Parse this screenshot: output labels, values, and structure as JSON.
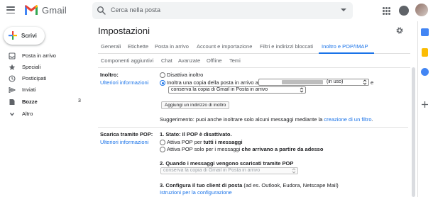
{
  "header": {
    "logo_text": "Gmail",
    "search_placeholder": "Cerca nella posta"
  },
  "compose": {
    "label": "Scrivi"
  },
  "sidebar": {
    "items": [
      {
        "label": "Posta in arrivo",
        "icon": "inbox-icon",
        "count": ""
      },
      {
        "label": "Speciali",
        "icon": "star-icon",
        "count": ""
      },
      {
        "label": "Posticipati",
        "icon": "clock-icon",
        "count": ""
      },
      {
        "label": "Inviati",
        "icon": "send-icon",
        "count": ""
      },
      {
        "label": "Bozze",
        "icon": "draft-icon",
        "count": "3"
      },
      {
        "label": "Altro",
        "icon": "chevron-down-icon",
        "count": ""
      }
    ]
  },
  "settings": {
    "title": "Impostazioni",
    "tabs_row1": [
      {
        "label": "Generali"
      },
      {
        "label": "Etichette"
      },
      {
        "label": "Posta in arrivo"
      },
      {
        "label": "Account e importazione"
      },
      {
        "label": "Filtri e indirizzi bloccati"
      },
      {
        "label": "Inoltro e POP/IMAP",
        "active": true
      }
    ],
    "tabs_row2": [
      {
        "label": "Componenti aggiuntivi"
      },
      {
        "label": "Chat"
      },
      {
        "label": "Avanzate"
      },
      {
        "label": "Offline"
      },
      {
        "label": "Temi"
      }
    ]
  },
  "forwarding": {
    "label": "Inoltro:",
    "learn_more": "Ulteriori informazioni",
    "option_disable": "Disattiva inoltro",
    "option_forward": "Inoltra una copia della posta in arrivo a",
    "address_status": "(in uso)",
    "conjunction": "e",
    "keep_option": "conserva la copia di Gmail in Posta in arrivo",
    "add_address_button": "Aggiungi un indirizzo di inoltro",
    "tip_prefix": "Suggerimento: puoi anche inoltrare solo alcuni messaggi mediante la",
    "tip_link": "creazione di un filtro",
    "tip_suffix": "."
  },
  "pop": {
    "label": "Scarica tramite POP:",
    "learn_more": "Ulteriori informazioni",
    "status": "1. Stato: Il POP è disattivato.",
    "opt1_prefix": "Attiva POP per",
    "opt1_bold": "tutti i messaggi",
    "opt2_prefix": "Attiva POP solo per i messaggi",
    "opt2_bold": "che arrivano a partire da adesso",
    "step2": "2. Quando i messaggi vengono scaricati tramite POP",
    "step2_select": "conserva la copia di Gmail in Posta in arrivo",
    "step3_bold": "3. Configura il tuo client di posta",
    "step3_rest": "(ad es. Outlook, Eudora, Netscape Mail)",
    "step3_link": "Istruzioni per la configurazione"
  },
  "colors": {
    "accent": "#1a73e8",
    "logo_red": "#ea4335",
    "text": "#202124",
    "muted": "#5f6368"
  }
}
